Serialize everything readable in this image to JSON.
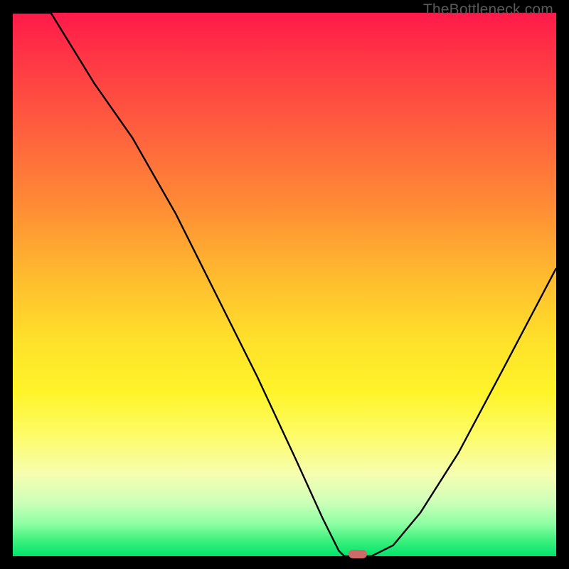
{
  "watermark": "TheBottleneck.com",
  "colors": {
    "frame": "#000000",
    "curve": "#000000",
    "marker": "#cf6a6a",
    "gradient_stops": [
      "#ff1a4a",
      "#ff3545",
      "#ff5a3f",
      "#ff8a35",
      "#ffb92f",
      "#ffe02a",
      "#fff42a",
      "#fdfc6a",
      "#f6fdb0",
      "#ceffb9",
      "#8effa3",
      "#3ff17e",
      "#00e46a"
    ]
  },
  "chart_data": {
    "type": "line",
    "title": "",
    "xlabel": "",
    "ylabel": "",
    "xlim": [
      0,
      1
    ],
    "ylim": [
      0,
      1
    ],
    "note": "x normalized 0–1 across plot width; y normalized 0 (bottom) – 1 (top). Curve is a V/notch reaching ~0 near x≈0.61–0.66, rising to ~1 at x≈0.07 and ~0.53 at x=1.",
    "series": [
      {
        "name": "bottleneck-curve",
        "x": [
          0.0,
          0.07,
          0.15,
          0.22,
          0.3,
          0.38,
          0.45,
          0.52,
          0.57,
          0.6,
          0.61,
          0.66,
          0.7,
          0.75,
          0.82,
          0.9,
          1.0
        ],
        "y": [
          1.0,
          1.0,
          0.87,
          0.77,
          0.63,
          0.47,
          0.33,
          0.18,
          0.07,
          0.01,
          0.0,
          0.0,
          0.02,
          0.08,
          0.19,
          0.34,
          0.53
        ]
      }
    ],
    "marker": {
      "x": 0.635,
      "y": 0.0,
      "width_frac": 0.035,
      "height_frac": 0.015
    }
  }
}
